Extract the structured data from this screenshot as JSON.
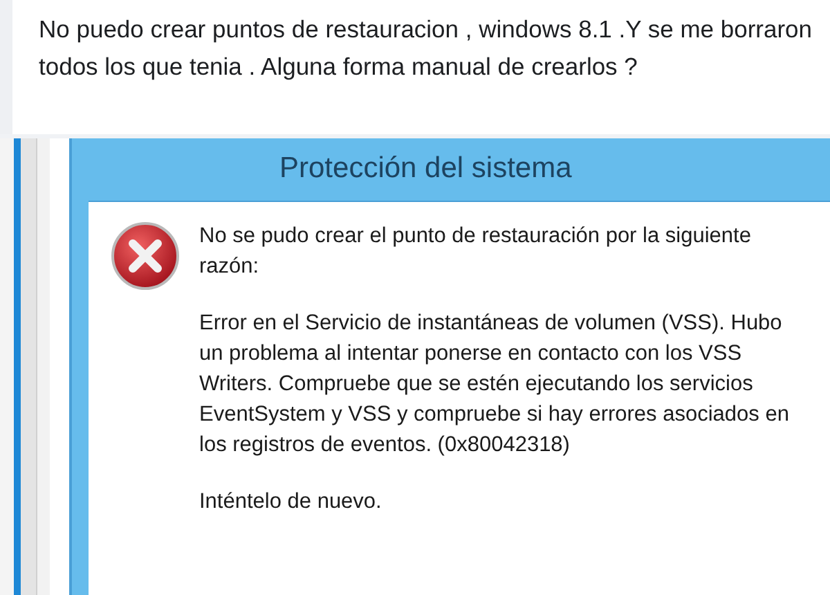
{
  "post": {
    "text": "No puedo crear puntos de restauracion , windows 8.1 .Y se me borraron todos los que tenia . Alguna forma manual de crearlos ?"
  },
  "dialog": {
    "title": "Protección del sistema",
    "message": "No se pudo crear el punto de restauración por la siguiente razón:",
    "details": "Error en el Servicio de instantáneas de volumen (VSS). Hubo un problema al intentar ponerse en contacto con los VSS Writers. Compruebe que se estén ejecutando los servicios EventSystem y VSS y compruebe si hay errores asociados en los registros de eventos. (0x80042318)",
    "retry": "Inténtelo de nuevo."
  }
}
